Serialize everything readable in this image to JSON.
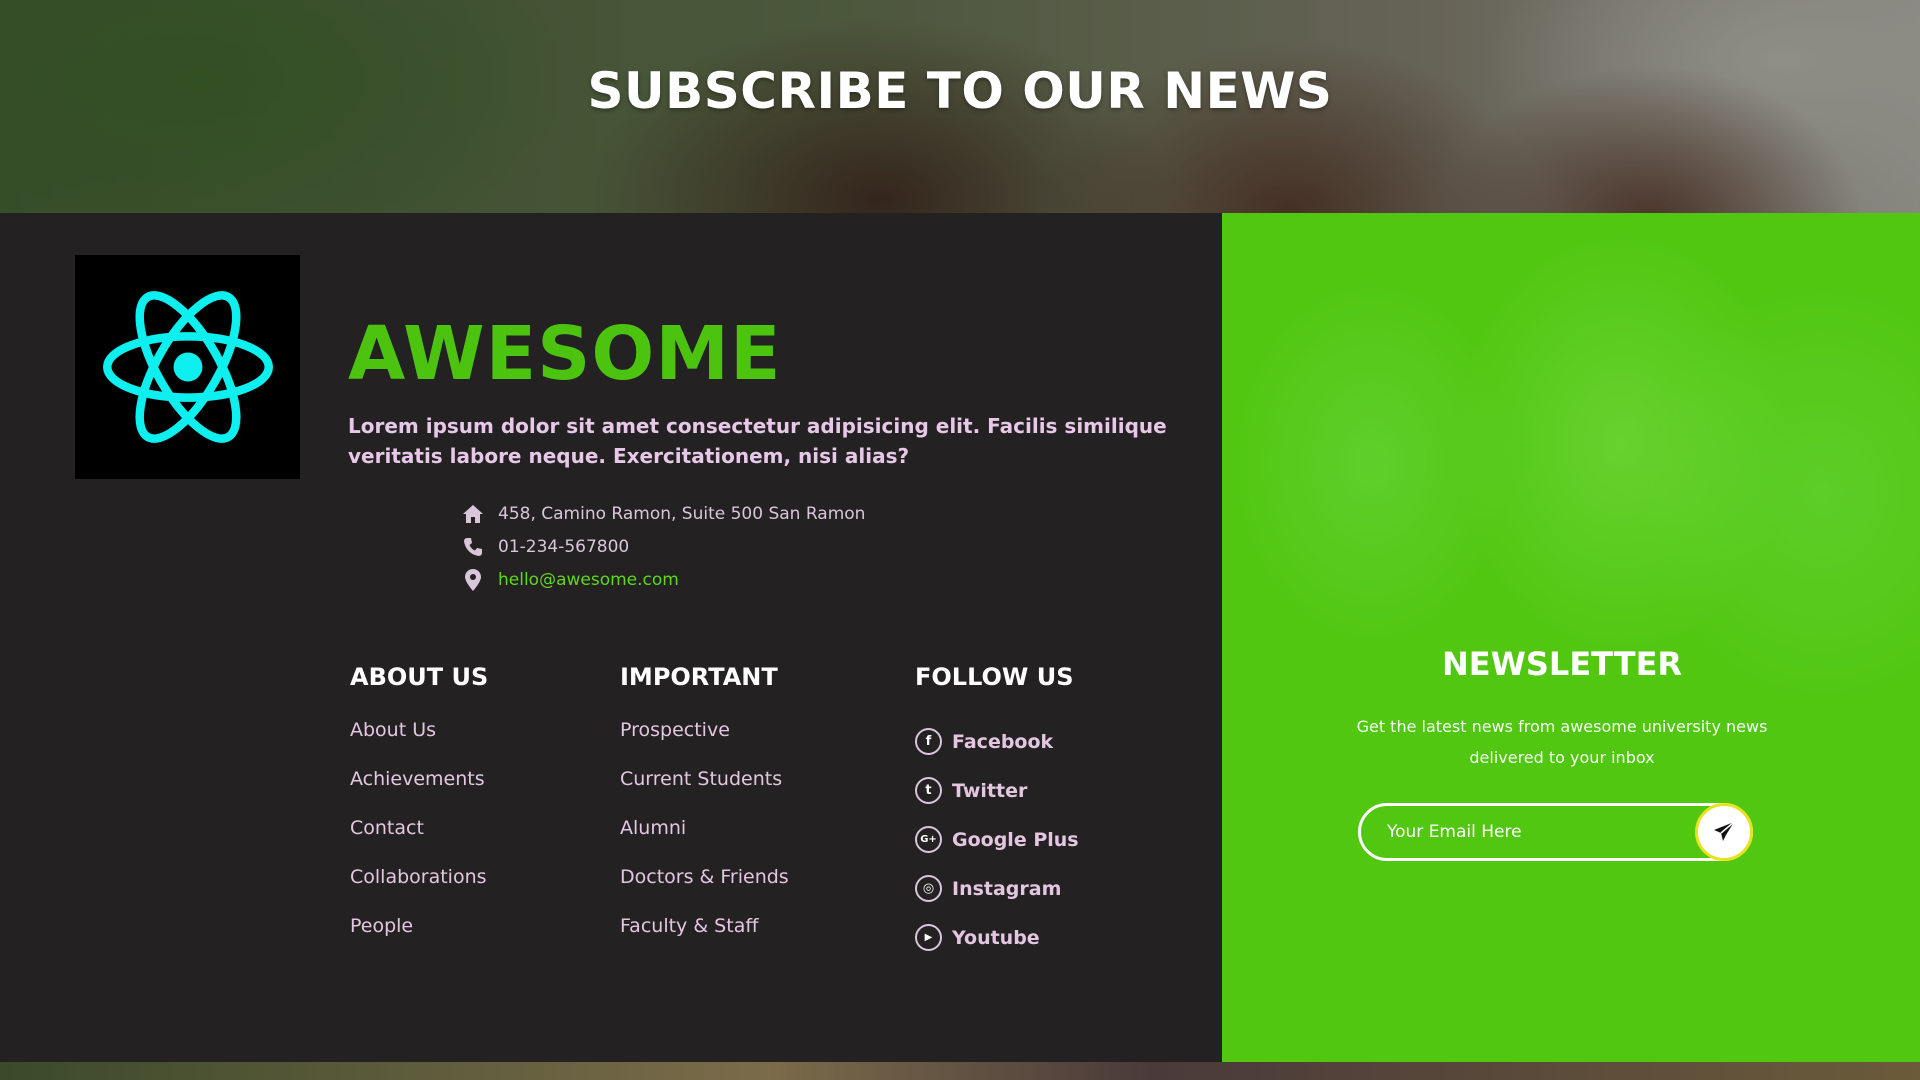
{
  "hero": {
    "title": "SUBSCRIBE TO OUR NEWS"
  },
  "brand": {
    "name": "AWESOME",
    "logo_icon": "react-atom-icon",
    "logo_color": "#0ef0f0",
    "description": "Lorem ipsum dolor sit amet consectetur adipisicing elit. Facilis similique veritatis labore neque. Exercitationem, nisi alias?"
  },
  "contact": {
    "address": "458, Camino Ramon, Suite 500 San Ramon",
    "address_icon": "home-icon",
    "phone": "01-234-567800",
    "phone_icon": "phone-icon",
    "email": "hello@awesome.com",
    "email_icon": "map-pin-icon"
  },
  "columns": {
    "about": {
      "title": "ABOUT US",
      "links": [
        "About Us",
        "Achievements",
        "Contact",
        "Collaborations",
        "People"
      ]
    },
    "important": {
      "title": "IMPORTANT",
      "links": [
        "Prospective",
        "Current Students",
        "Alumni",
        "Doctors & Friends",
        "Faculty & Staff"
      ]
    },
    "follow": {
      "title": "FOLLOW US",
      "links": [
        {
          "label": "Facebook",
          "icon": "facebook-icon",
          "glyph": "f"
        },
        {
          "label": "Twitter",
          "icon": "twitter-icon",
          "glyph": "t"
        },
        {
          "label": "Google Plus",
          "icon": "google-plus-icon",
          "glyph": "G+"
        },
        {
          "label": "Instagram",
          "icon": "instagram-icon",
          "glyph": "◎"
        },
        {
          "label": "Youtube",
          "icon": "youtube-icon",
          "glyph": "▶"
        }
      ]
    }
  },
  "newsletter": {
    "title": "NEWSLETTER",
    "text": "Get the latest news from awesome university news delivered to your inbox",
    "input_placeholder": "Your Email Here",
    "submit_icon": "send-icon"
  },
  "colors": {
    "accent_green": "#4cc30f",
    "panel_green": "#52c712",
    "footer_dark": "#232122",
    "link_pink": "#e3c6e0"
  }
}
